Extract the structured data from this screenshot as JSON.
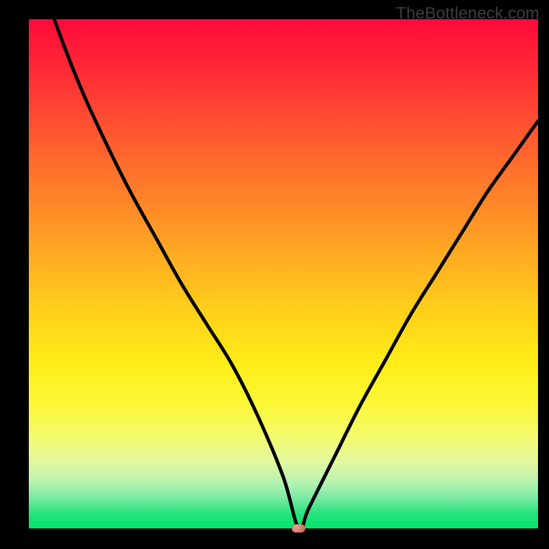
{
  "watermark": "TheBottleneck.com",
  "colors": {
    "frame": "#000000",
    "curve": "#000000",
    "marker": "#d07868",
    "gradient_stops": [
      "#ff0a3a",
      "#ff5630",
      "#ffaa22",
      "#ffee18",
      "#e2f8a0",
      "#00e56a"
    ]
  },
  "chart_data": {
    "type": "line",
    "title": "",
    "xlabel": "",
    "ylabel": "",
    "xlim": [
      0,
      100
    ],
    "ylim": [
      0,
      100
    ],
    "note": "V-shaped bottleneck curve, minimum at x≈53; y is % bottleneck (0=bottom/green, 100=top/red)",
    "x": [
      0,
      5,
      10,
      15,
      20,
      25,
      30,
      35,
      40,
      45,
      50,
      53,
      55,
      60,
      65,
      70,
      75,
      80,
      85,
      90,
      95,
      100
    ],
    "y": [
      115,
      100,
      87,
      76,
      66,
      57,
      48,
      40,
      32,
      22,
      10,
      0,
      4,
      14,
      24,
      33,
      42,
      50,
      58,
      66,
      73,
      80
    ],
    "marker": {
      "x": 53,
      "y": 0
    }
  }
}
